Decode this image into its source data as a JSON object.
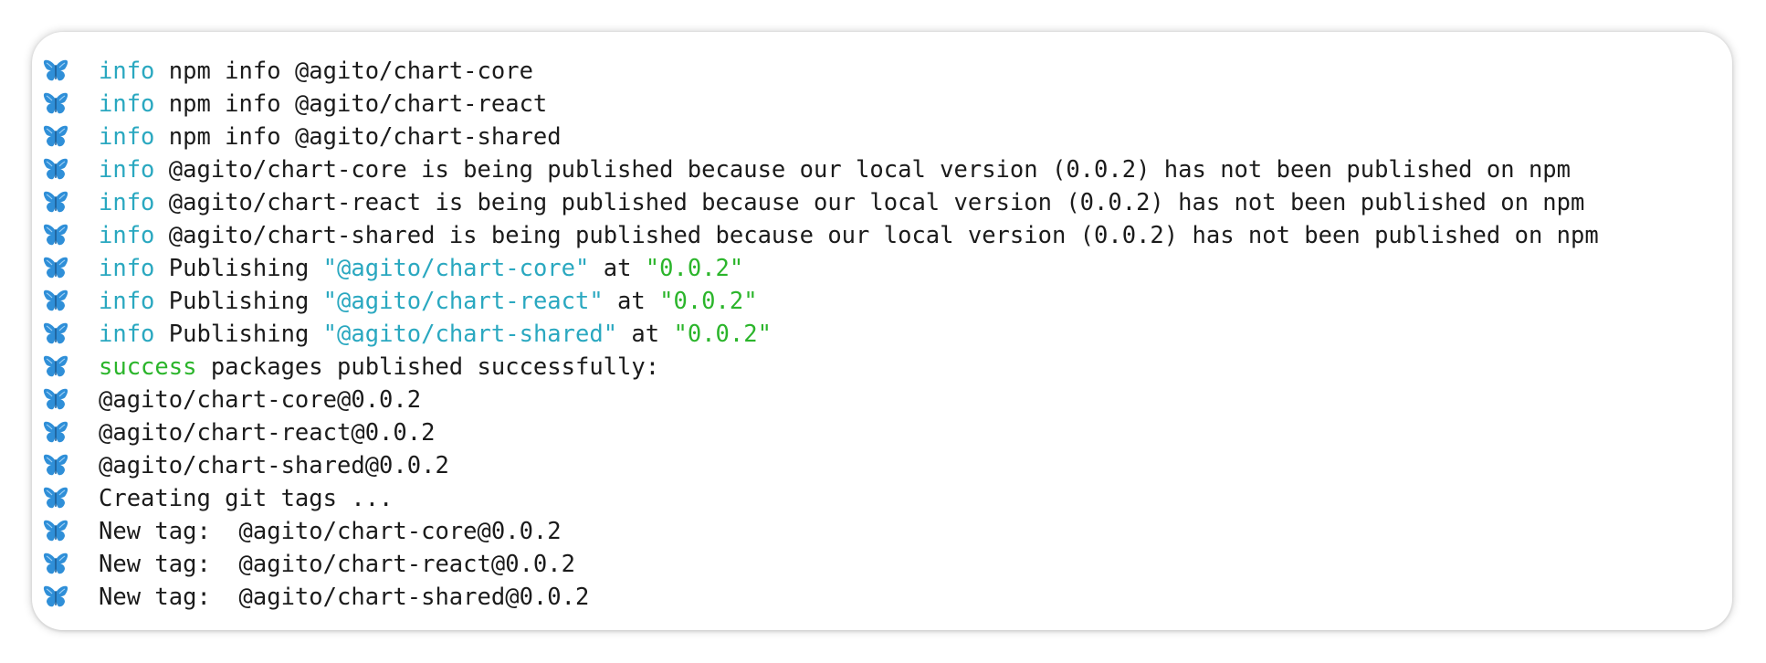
{
  "colors": {
    "info": "#2aa8c0",
    "success": "#2bb52b",
    "text": "#1b1b1b",
    "butterfly": "#2f8fd8"
  },
  "icon": "butterfly-icon",
  "lines": [
    {
      "level": "info",
      "plain": " npm info @agito/chart-core"
    },
    {
      "level": "info",
      "plain": " npm info @agito/chart-react"
    },
    {
      "level": "info",
      "plain": " npm info @agito/chart-shared"
    },
    {
      "level": "info",
      "plain": " @agito/chart-core is being published because our local version (0.0.2) has not been published on npm"
    },
    {
      "level": "info",
      "plain": " @agito/chart-react is being published because our local version (0.0.2) has not been published on npm"
    },
    {
      "level": "info",
      "plain": " @agito/chart-shared is being published because our local version (0.0.2) has not been published on npm"
    },
    {
      "level": "info",
      "pre": " Publishing ",
      "pkg": "\"@agito/chart-core\"",
      "mid": " at ",
      "ver": "\"0.0.2\""
    },
    {
      "level": "info",
      "pre": " Publishing ",
      "pkg": "\"@agito/chart-react\"",
      "mid": " at ",
      "ver": "\"0.0.2\""
    },
    {
      "level": "info",
      "pre": " Publishing ",
      "pkg": "\"@agito/chart-shared\"",
      "mid": " at ",
      "ver": "\"0.0.2\""
    },
    {
      "level": "success",
      "plain": " packages published successfully:"
    },
    {
      "level": "",
      "plain": "@agito/chart-core@0.0.2"
    },
    {
      "level": "",
      "plain": "@agito/chart-react@0.0.2"
    },
    {
      "level": "",
      "plain": "@agito/chart-shared@0.0.2"
    },
    {
      "level": "",
      "plain": "Creating git tags ..."
    },
    {
      "level": "",
      "plain": "New tag:  @agito/chart-core@0.0.2"
    },
    {
      "level": "",
      "plain": "New tag:  @agito/chart-react@0.0.2"
    },
    {
      "level": "",
      "plain": "New tag:  @agito/chart-shared@0.0.2"
    }
  ]
}
